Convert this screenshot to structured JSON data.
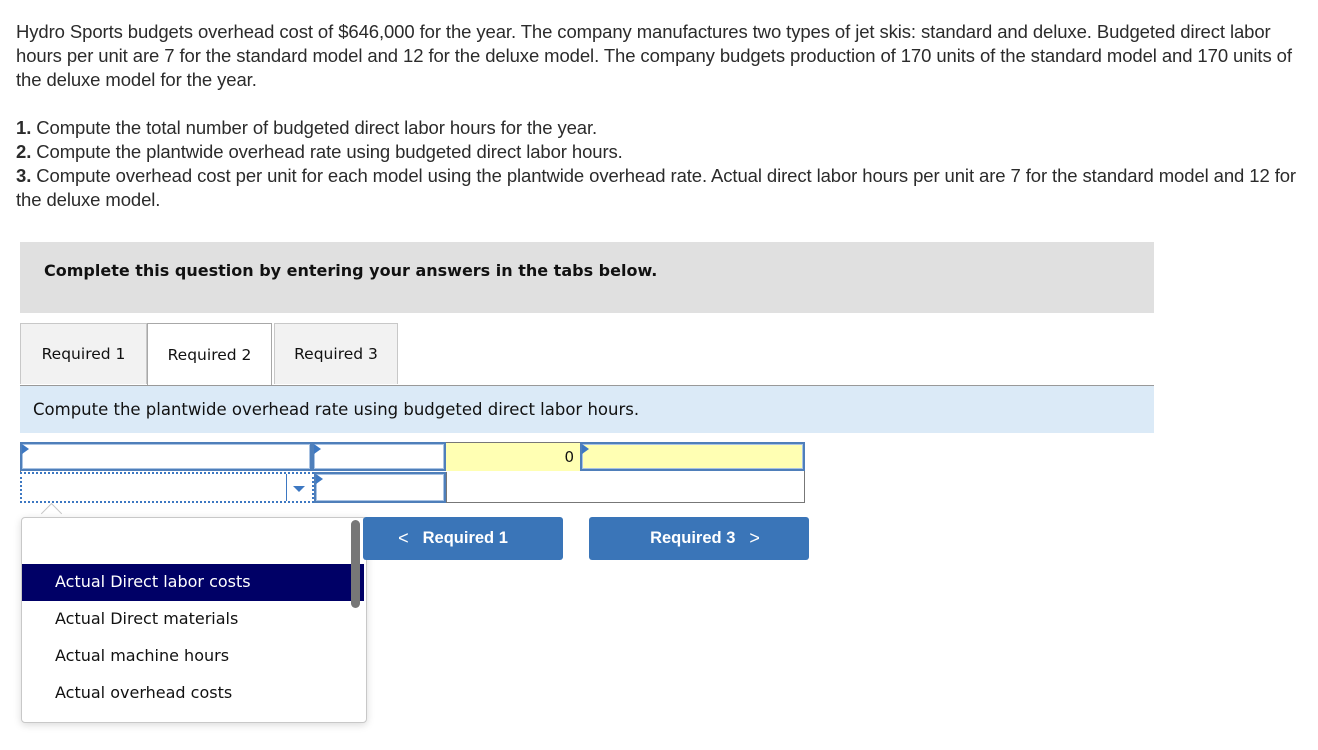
{
  "question": {
    "paragraph": "Hydro Sports budgets overhead cost of $646,000 for the year. The company manufactures two types of jet skis: standard and deluxe. Budgeted direct labor hours per unit are 7 for the standard model and 12 for the deluxe model. The company budgets production of 170 units of the standard model and 170 units of the deluxe model for the year.",
    "requirements": [
      {
        "num": "1.",
        "text": "Compute the total number of budgeted direct labor hours for the year."
      },
      {
        "num": "2.",
        "text": "Compute the plantwide overhead rate using budgeted direct labor hours."
      },
      {
        "num": "3.",
        "text": "Compute overhead cost per unit for each model using the plantwide overhead rate. Actual direct labor hours per unit are 7 for the standard model and 12 for the deluxe model."
      }
    ]
  },
  "banner": {
    "text": "Complete this question by entering your answers in the tabs below."
  },
  "tabs": [
    {
      "label": "Required 1",
      "active": false
    },
    {
      "label": "Required 2",
      "active": true
    },
    {
      "label": "Required 3",
      "active": false
    }
  ],
  "instruction": "Compute the plantwide overhead rate using budgeted direct labor hours.",
  "grid": {
    "row1": {
      "label_value": "",
      "amount_value": "",
      "result_value": "0",
      "unit_value": ""
    },
    "row2": {
      "select_value": "",
      "amount_value": ""
    }
  },
  "dropdown": {
    "options": [
      "",
      "Actual Direct labor costs",
      "Actual Direct materials",
      "Actual machine hours",
      "Actual overhead costs"
    ],
    "highlighted": "Actual Direct labor costs"
  },
  "nav": {
    "prev_label": "Required 1",
    "next_label": "Required 3",
    "prev_icon": "chevron-left-icon",
    "next_icon": "chevron-right-icon"
  },
  "colors": {
    "accent": "#3a75b8",
    "highlight": "#000066",
    "answer_cell": "#ffffb3",
    "instruction_bg": "#dbeaf7",
    "banner_bg": "#e0e0e0"
  }
}
